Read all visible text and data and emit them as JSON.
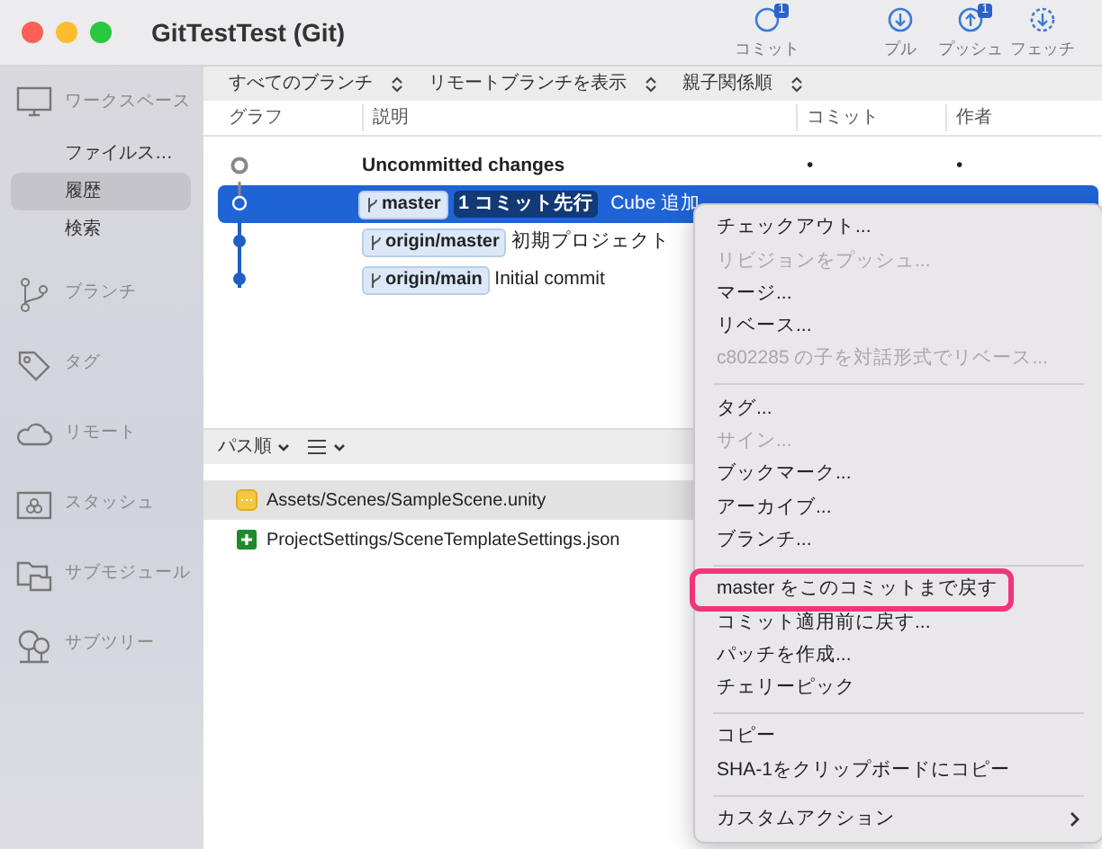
{
  "window": {
    "title": "GitTestTest (Git)"
  },
  "toolbar": [
    {
      "label": "コミット",
      "badge": "1"
    },
    {
      "label": "プル"
    },
    {
      "label": "プッシュ",
      "badge": "1"
    },
    {
      "label": "フェッチ"
    }
  ],
  "sidebar": [
    {
      "label": "ワークスペース",
      "children": [
        {
          "label": "ファイルス…",
          "selected": false
        },
        {
          "label": "履歴",
          "selected": true
        },
        {
          "label": "検索",
          "selected": false
        }
      ]
    },
    {
      "label": "ブランチ"
    },
    {
      "label": "タグ"
    },
    {
      "label": "リモート"
    },
    {
      "label": "スタッシュ"
    },
    {
      "label": "サブモジュール"
    },
    {
      "label": "サブツリー"
    }
  ],
  "filters": [
    "すべてのブランチ",
    "リモートブランチを表示",
    "親子関係順"
  ],
  "columns": [
    "グラフ",
    "説明",
    "コミット",
    "作者"
  ],
  "commits": [
    {
      "kind": "uncommitted",
      "selected": false,
      "description": "Uncommitted changes",
      "commit": "•",
      "author": "•"
    },
    {
      "kind": "commit",
      "selected": true,
      "branches": [
        {
          "name": "master",
          "ahead": "1 コミット先行"
        }
      ],
      "description": "Cube 追加"
    },
    {
      "kind": "commit",
      "selected": false,
      "branches": [
        {
          "name": "origin/master"
        }
      ],
      "description": "初期プロジェクト"
    },
    {
      "kind": "commit",
      "selected": false,
      "branches": [
        {
          "name": "origin/main"
        }
      ],
      "description": "Initial commit"
    }
  ],
  "file_toolbar": {
    "sort": "パス順"
  },
  "files": [
    {
      "path": "Assets/Scenes/SampleScene.unity",
      "kind": "modified",
      "selected": true
    },
    {
      "path": "ProjectSettings/SceneTemplateSettings.json",
      "kind": "added",
      "selected": false
    }
  ],
  "context_menu": [
    {
      "kind": "item",
      "label": "チェックアウト...",
      "disabled": false
    },
    {
      "kind": "item",
      "label": "リビジョンをプッシュ...",
      "disabled": true
    },
    {
      "kind": "item",
      "label": "マージ...",
      "disabled": false
    },
    {
      "kind": "item",
      "label": "リベース...",
      "disabled": false
    },
    {
      "kind": "item",
      "label": "c802285 の子を対話形式でリベース...",
      "disabled": true
    },
    {
      "kind": "separator"
    },
    {
      "kind": "item",
      "label": "タグ...",
      "disabled": false
    },
    {
      "kind": "item",
      "label": "サイン...",
      "disabled": true
    },
    {
      "kind": "item",
      "label": "ブックマーク...",
      "disabled": false
    },
    {
      "kind": "item",
      "label": "アーカイブ...",
      "disabled": false
    },
    {
      "kind": "item",
      "label": "ブランチ...",
      "disabled": false
    },
    {
      "kind": "separator"
    },
    {
      "kind": "item",
      "label": "master をこのコミットまで戻す",
      "disabled": false,
      "highlighted": true
    },
    {
      "kind": "item",
      "label": "コミット適用前に戻す...",
      "disabled": false
    },
    {
      "kind": "item",
      "label": "パッチを作成...",
      "disabled": false
    },
    {
      "kind": "item",
      "label": "チェリーピック",
      "disabled": false
    },
    {
      "kind": "separator"
    },
    {
      "kind": "item",
      "label": "コピー",
      "disabled": false
    },
    {
      "kind": "item",
      "label": "SHA-1をクリップボードにコピー",
      "disabled": false
    },
    {
      "kind": "separator"
    },
    {
      "kind": "item",
      "label": "カスタムアクション",
      "disabled": false,
      "submenu": true
    }
  ]
}
